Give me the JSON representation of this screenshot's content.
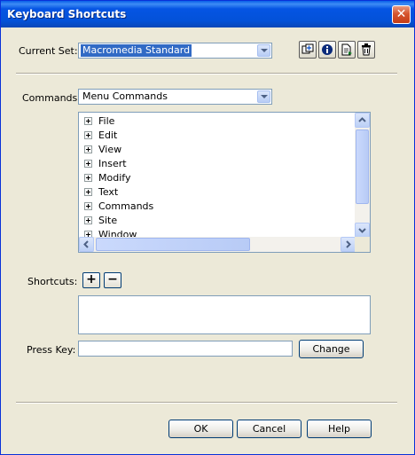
{
  "window": {
    "title": "Keyboard Shortcuts",
    "close_glyph": "✕"
  },
  "current_set": {
    "label": "Current Set:",
    "value": "Macromedia Standard"
  },
  "toolbar_icons": [
    "duplicate-set-icon",
    "info-icon",
    "export-set-icon",
    "delete-set-icon"
  ],
  "commands": {
    "label": "Commands:",
    "value": "Menu Commands"
  },
  "tree": {
    "items": [
      "File",
      "Edit",
      "View",
      "Insert",
      "Modify",
      "Text",
      "Commands",
      "Site",
      "Window"
    ]
  },
  "shortcuts": {
    "label": "Shortcuts:",
    "add": "+",
    "remove": "−"
  },
  "press_key": {
    "label": "Press Key:",
    "value": "",
    "change_button": "Change"
  },
  "buttons": {
    "ok": "OK",
    "cancel": "Cancel",
    "help": "Help"
  },
  "colors": {
    "title_bar": "#0554e3",
    "selection": "#316ac5",
    "window_bg": "#ece9d8"
  }
}
